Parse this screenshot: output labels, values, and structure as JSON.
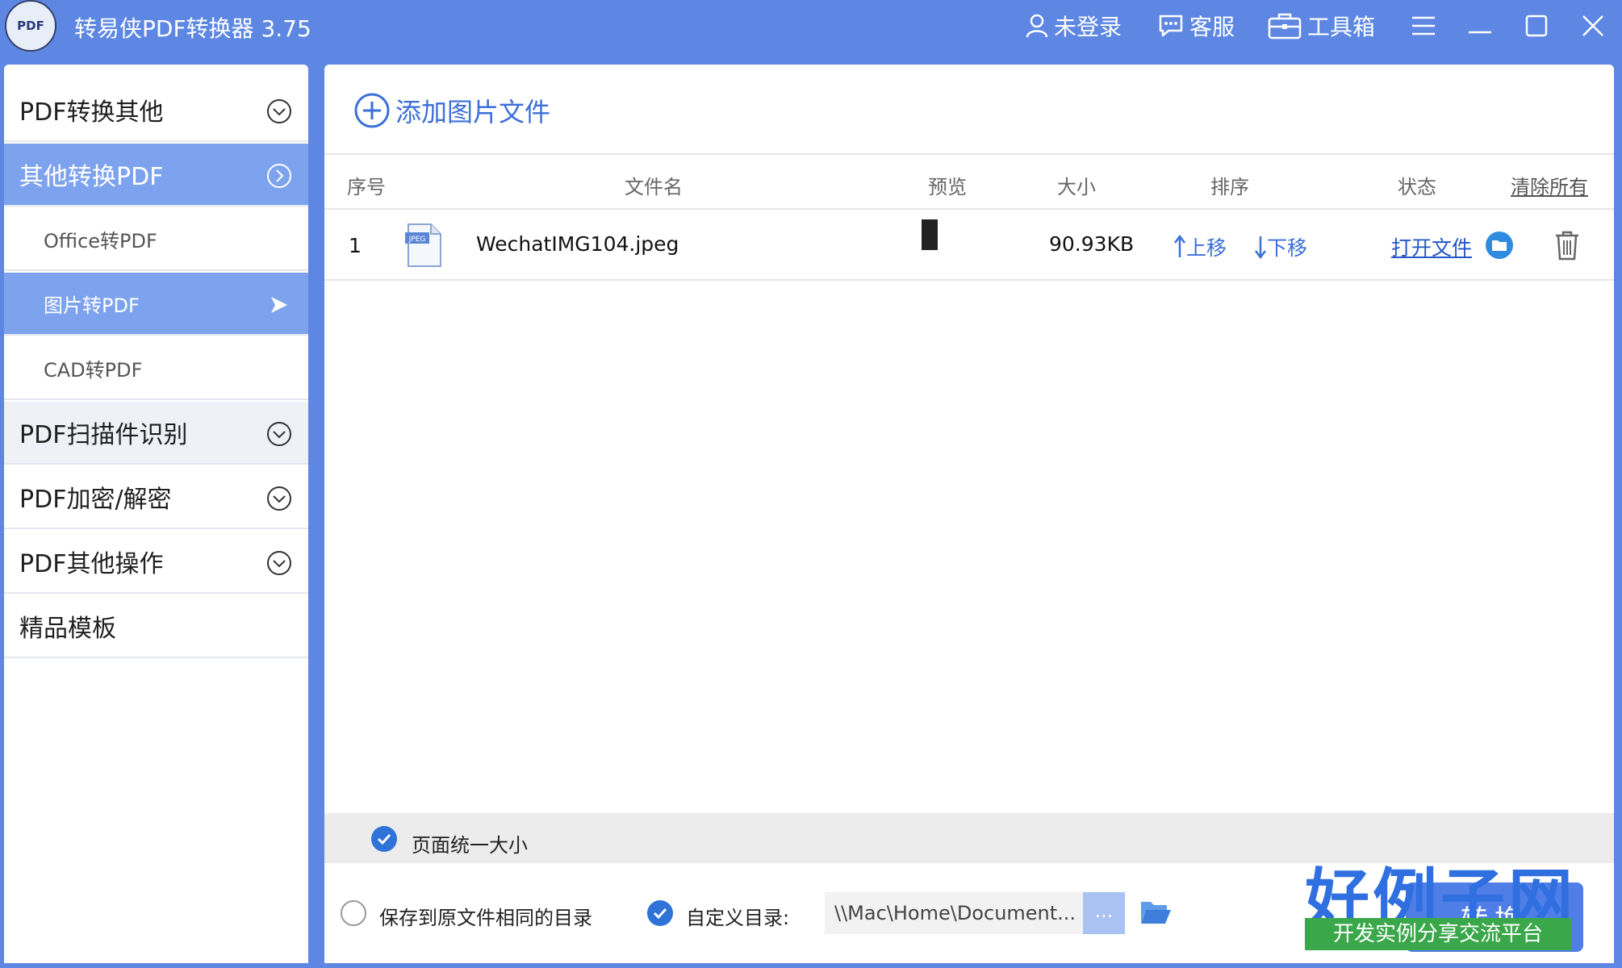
{
  "app": {
    "logo_text": "PDF",
    "title": "转易侠PDF转换器 3.75",
    "login": "未登录",
    "service": "客服",
    "toolbox": "工具箱"
  },
  "sidebar": {
    "items": [
      {
        "label": "PDF转换其他"
      },
      {
        "label": "其他转换PDF"
      },
      {
        "label": "Office转PDF"
      },
      {
        "label": "图片转PDF"
      },
      {
        "label": "CAD转PDF"
      },
      {
        "label": "PDF扫描件识别"
      },
      {
        "label": "PDF加密/解密"
      },
      {
        "label": "PDF其他操作"
      },
      {
        "label": "精品模板"
      }
    ]
  },
  "main": {
    "add_button": "添加图片文件",
    "columns": {
      "index": "序号",
      "filename": "文件名",
      "preview": "预览",
      "size": "大小",
      "sort": "排序",
      "status": "状态",
      "clear_all": "清除所有"
    },
    "rows": [
      {
        "index": "1",
        "file_type": "JPEG",
        "filename": "WechatIMG104.jpeg",
        "size": "90.93KB",
        "move_up": "上移",
        "move_down": "下移",
        "open_file": "打开文件"
      }
    ],
    "options": {
      "unify_page_size": "页面统一大小",
      "save_same_dir": "保存到原文件相同的目录",
      "custom_dir": "自定义目录:",
      "path": "\\\\Mac\\Home\\Document...",
      "dots": "...",
      "convert": "转换"
    },
    "watermark": {
      "big": "好例子网",
      "small": "开发实例分享交流平台"
    }
  },
  "colors": {
    "titlebar": "#5d87e2",
    "active_menu": "#7ea3ee",
    "accent": "#3c6fd8",
    "check": "#2f73d9"
  }
}
